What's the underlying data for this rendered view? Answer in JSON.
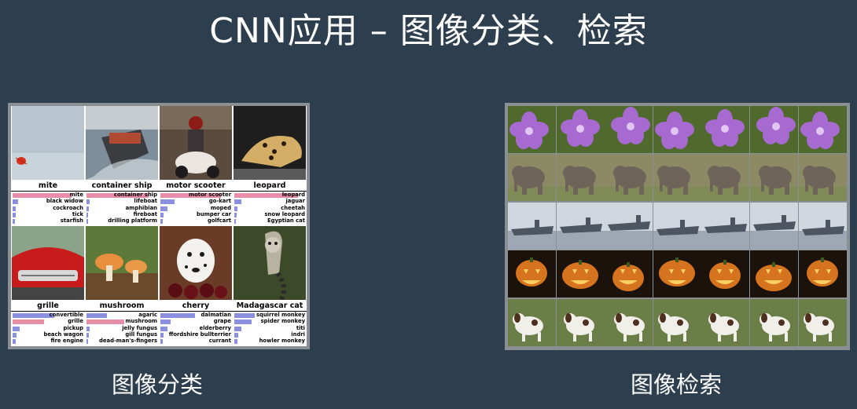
{
  "slide": {
    "title": "CNN应用 – 图像分类、检索",
    "caption_left": "图像分类",
    "caption_right": "图像检索"
  },
  "classification": {
    "rows": [
      [
        {
          "label": "mite",
          "photo": "water-mite-photo",
          "predictions": [
            {
              "text": "mite",
              "score": 0.85,
              "correct": true
            },
            {
              "text": "black widow",
              "score": 0.08,
              "correct": false
            },
            {
              "text": "cockroach",
              "score": 0.05,
              "correct": false
            },
            {
              "text": "tick",
              "score": 0.04,
              "correct": false
            },
            {
              "text": "starfish",
              "score": 0.03,
              "correct": false
            }
          ]
        },
        {
          "label": "container ship",
          "photo": "container-ship-photo",
          "predictions": [
            {
              "text": "container ship",
              "score": 0.9,
              "correct": true
            },
            {
              "text": "lifeboat",
              "score": 0.05,
              "correct": false
            },
            {
              "text": "amphibian",
              "score": 0.03,
              "correct": false
            },
            {
              "text": "fireboat",
              "score": 0.02,
              "correct": false
            },
            {
              "text": "drilling platform",
              "score": 0.02,
              "correct": false
            }
          ]
        },
        {
          "label": "motor scooter",
          "photo": "motor-scooter-photo",
          "predictions": [
            {
              "text": "motor scooter",
              "score": 0.88,
              "correct": true
            },
            {
              "text": "go-kart",
              "score": 0.2,
              "correct": false
            },
            {
              "text": "moped",
              "score": 0.1,
              "correct": false
            },
            {
              "text": "bumper car",
              "score": 0.05,
              "correct": false
            },
            {
              "text": "golfcart",
              "score": 0.03,
              "correct": false
            }
          ]
        },
        {
          "label": "leopard",
          "photo": "leopard-photo",
          "predictions": [
            {
              "text": "leopard",
              "score": 0.92,
              "correct": true
            },
            {
              "text": "jaguar",
              "score": 0.1,
              "correct": false
            },
            {
              "text": "cheetah",
              "score": 0.05,
              "correct": false
            },
            {
              "text": "snow leopard",
              "score": 0.03,
              "correct": false
            },
            {
              "text": "Egyptian cat",
              "score": 0.02,
              "correct": false
            }
          ]
        }
      ],
      [
        {
          "label": "grille",
          "photo": "red-car-grille-photo",
          "predictions": [
            {
              "text": "convertible",
              "score": 0.6,
              "correct": false
            },
            {
              "text": "grille",
              "score": 0.45,
              "correct": true
            },
            {
              "text": "pickup",
              "score": 0.1,
              "correct": false
            },
            {
              "text": "beach wagon",
              "score": 0.06,
              "correct": false
            },
            {
              "text": "fire engine",
              "score": 0.04,
              "correct": false
            }
          ]
        },
        {
          "label": "mushroom",
          "photo": "mushroom-photo",
          "predictions": [
            {
              "text": "agaric",
              "score": 0.3,
              "correct": false
            },
            {
              "text": "mushroom",
              "score": 0.55,
              "correct": true
            },
            {
              "text": "jelly fungus",
              "score": 0.05,
              "correct": false
            },
            {
              "text": "gill fungus",
              "score": 0.03,
              "correct": false
            },
            {
              "text": "dead-man's-fingers",
              "score": 0.02,
              "correct": false
            }
          ]
        },
        {
          "label": "cherry",
          "photo": "dalmatian-cherry-photo",
          "predictions": [
            {
              "text": "dalmatian",
              "score": 0.5,
              "correct": false
            },
            {
              "text": "grape",
              "score": 0.15,
              "correct": false
            },
            {
              "text": "elderberry",
              "score": 0.1,
              "correct": false
            },
            {
              "text": "ffordshire bullterrier",
              "score": 0.05,
              "correct": false
            },
            {
              "text": "currant",
              "score": 0.03,
              "correct": false
            }
          ]
        },
        {
          "label": "Madagascar cat",
          "photo": "lemur-photo",
          "predictions": [
            {
              "text": "squirrel monkey",
              "score": 0.3,
              "correct": false
            },
            {
              "text": "spider monkey",
              "score": 0.25,
              "correct": false
            },
            {
              "text": "titi",
              "score": 0.1,
              "correct": false
            },
            {
              "text": "indri",
              "score": 0.06,
              "correct": false
            },
            {
              "text": "howler monkey",
              "score": 0.04,
              "correct": false
            }
          ]
        }
      ]
    ]
  },
  "retrieval": {
    "rows": [
      {
        "subject": "purple-flower",
        "cells": 7,
        "colors": {
          "bg": "#4f6a2c",
          "main": "#a66ad0",
          "accent": "#e2c6f2"
        }
      },
      {
        "subject": "elephant",
        "cells": 7,
        "colors": {
          "bg": "#8c8a64",
          "main": "#6e645a",
          "accent": "#b0ad8c"
        }
      },
      {
        "subject": "aircraft-carrier",
        "cells": 7,
        "colors": {
          "bg": "#9ea8b4",
          "main": "#4d5660",
          "accent": "#cfd6de"
        }
      },
      {
        "subject": "jack-o-lantern",
        "cells": 7,
        "colors": {
          "bg": "#1c120c",
          "main": "#d6731e",
          "accent": "#ffcf62"
        }
      },
      {
        "subject": "spotted-dog",
        "cells": 7,
        "colors": {
          "bg": "#6b7e48",
          "main": "#f1efe9",
          "accent": "#4e2f1e"
        }
      }
    ]
  }
}
